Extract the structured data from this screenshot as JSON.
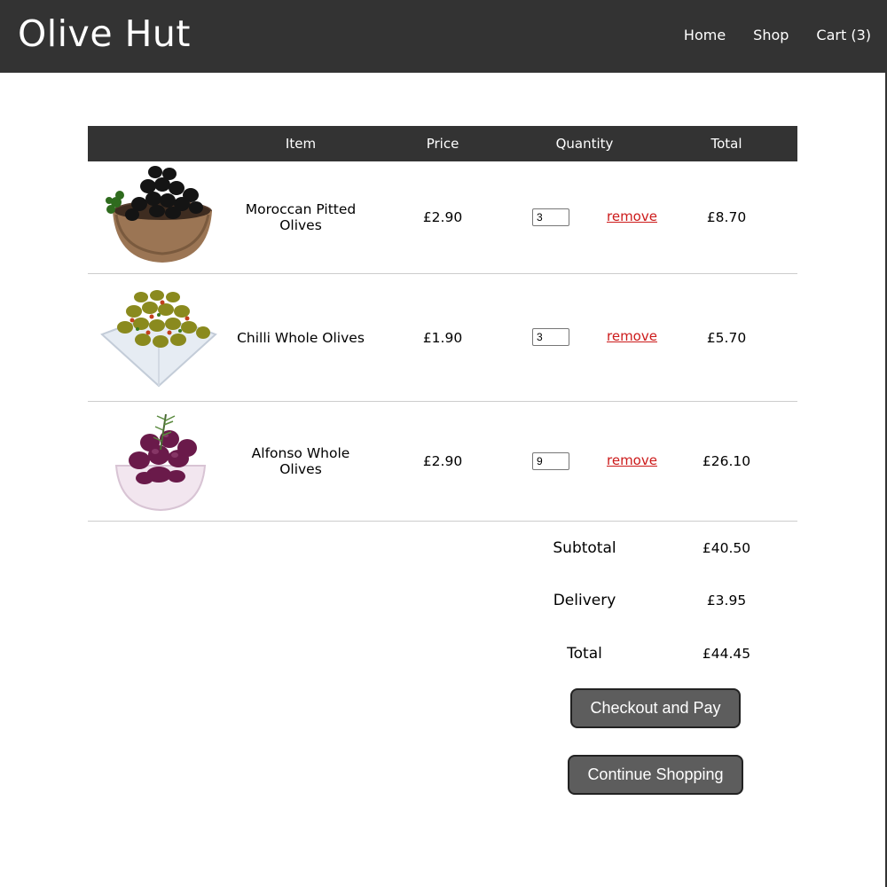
{
  "brand": {
    "name": "Olive Hut"
  },
  "nav": {
    "home": "Home",
    "shop": "Shop",
    "cart": "Cart (3)"
  },
  "cart_table": {
    "headers": {
      "item": "Item",
      "price": "Price",
      "quantity": "Quantity",
      "total": "Total"
    },
    "remove_label": "remove",
    "rows": [
      {
        "name": "Moroccan Pitted Olives",
        "price": "£2.90",
        "quantity": "3",
        "total": "£8.70",
        "image": "black-olives-in-wooden-bowl"
      },
      {
        "name": "Chilli Whole Olives",
        "price": "£1.90",
        "quantity": "3",
        "total": "£5.70",
        "image": "green-olives-in-white-dish"
      },
      {
        "name": "Alfonso Whole Olives",
        "price": "£2.90",
        "quantity": "9",
        "total": "£26.10",
        "image": "purple-olives-in-glass-bowl"
      }
    ]
  },
  "summary": {
    "subtotal_label": "Subtotal",
    "subtotal": "£40.50",
    "delivery_label": "Delivery",
    "delivery": "£3.95",
    "total_label": "Total",
    "total": "£44.45"
  },
  "actions": {
    "checkout": "Checkout and Pay",
    "continue": "Continue Shopping"
  },
  "colors": {
    "header_bg": "#333333",
    "link_red": "#cc1a1a",
    "button_bg": "#5d5d5d"
  }
}
